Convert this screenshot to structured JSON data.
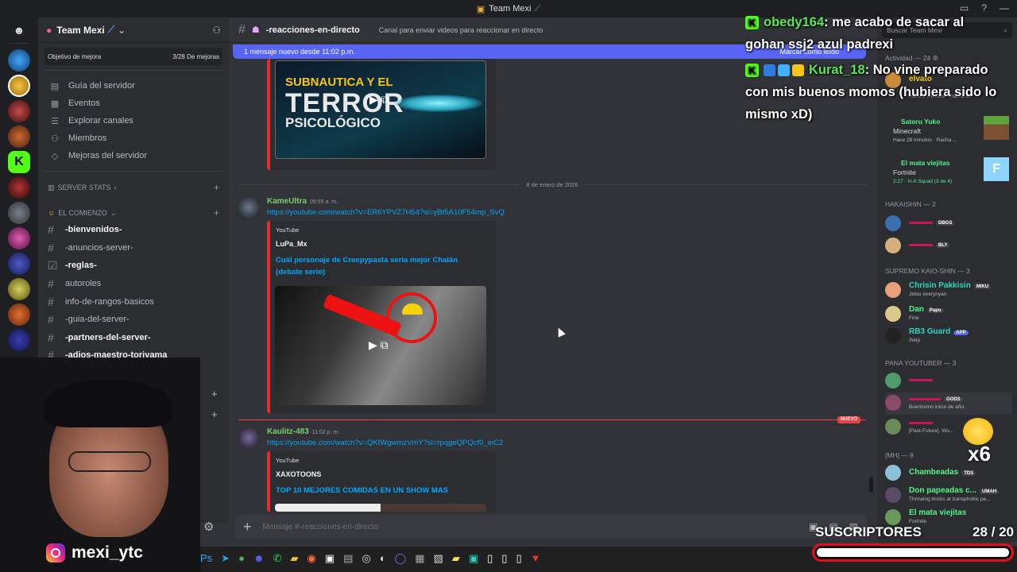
{
  "window": {
    "title": "Team Mexi"
  },
  "server": {
    "name": "Team Mexi",
    "boost_label": "Objetivo de mejora",
    "boost_count": "3/28 De mejoras"
  },
  "nav": [
    "Guía del servidor",
    "Eventos",
    "Explorar canales",
    "Miembros",
    "Mejoras del servidor"
  ],
  "categories": {
    "stats": "SERVER STATS",
    "comienzo": "EL COMIENZO"
  },
  "channels": [
    "-bienvenidos-",
    "-anuncios-server-",
    "-reglas-",
    "autoroles",
    "info-de-rangos-basicos",
    "-guia-del-server-",
    "-partners-del-server-",
    "-adios-maestro-toriyama"
  ],
  "channel": {
    "name": "-reacciones-en-directo",
    "topic": "Canal para enviar videos para reaccionar en directo"
  },
  "newbar": {
    "text": "1 mensaje nuevo desde 11:02 p.m.",
    "action": "Marcar como leído"
  },
  "thumb1": {
    "line1": "SUBNAUTICA Y EL",
    "line2": "TERROR",
    "line3": "PSICOLÓGICO"
  },
  "date_separator": "8 de enero de 2026",
  "messages": [
    {
      "author": "KameUltra",
      "time": "09:55 a. m.",
      "link": "https://youtube.com/watch?v=ER6YPVZ7H54?si=yBt5A10F54mp_SvQ",
      "embed_source": "YouTube",
      "embed_author": "LuPa_Mx",
      "embed_title_1": "Cuál personaje de Creepypasta sería mejor Chalán",
      "embed_title_2": "(debate serio)"
    },
    {
      "author": "Kaulitz-483",
      "time": "11:02 p. m.",
      "link": "https://youtube.com/watch?v=QKtWgwmzVmY?si=rpqgeQPQcf0_eiC2",
      "embed_source": "YouTube",
      "embed_author": "XAXOTOONS",
      "embed_title_1": "TOP 10 MEJORES COMIDAS EN UN SHOW MAS"
    }
  ],
  "new_badge": "NUEVO",
  "composer": {
    "placeholder": "Mensaje #-reacciones-en-directo"
  },
  "members": {
    "search": "Buscar Team Mexi",
    "activity_header": "Actividad — 24",
    "elvato": {
      "name": "elvato",
      "status": "Hace 2 minutos · Racha d..."
    },
    "satoru": {
      "name": "Satoru Yuko",
      "game": "Minecraft",
      "status": "Hace 28 minutos · Racha ..."
    },
    "matav": {
      "name": "El mata viejitas",
      "game": "Fortnite",
      "status": "2:27 · In A Squad (3 de 4)"
    },
    "hakaishin_header": "HAKAISHIN — 2",
    "haka1": {
      "tag": "DBGS"
    },
    "haka2": {
      "tag": "BLY"
    },
    "supremo_header": "SUPREMO KAIO-SHIN — 3",
    "chrisin": {
      "name": "Chrisin Pakkisin",
      "tag": "MIKU",
      "status": "Jelou everynyan"
    },
    "dan": {
      "name": "Dan",
      "tag": "Papu",
      "status": "Fine"
    },
    "rb3": {
      "name": "RB3 Guard",
      "tag": "APP",
      "status": "/help"
    },
    "pana_header": "PANA YOUTUBER — 3",
    "pana2": {
      "tag": "GODS",
      "status": "Buenísimo inicio de año."
    },
    "pana3": {
      "status": "[Past-Future]. Wo..."
    },
    "mh_header": "[MH] — 8",
    "chambeadas": {
      "name": "Chambeadas",
      "tag": "TDS"
    },
    "donpap": {
      "name": "Don papeadas c...",
      "tag": "UMAH",
      "status": "Throwing bricks at transphobic pe..."
    },
    "matav2": {
      "name": "El mata viejitas",
      "status": "Fortnite"
    }
  },
  "overlay": {
    "chat": [
      {
        "user": "obedy164",
        "text": ": me acabo de sacar al",
        "cont": "gohan ssj2 azul padrexi"
      },
      {
        "user": "Kurat_18",
        "text": ": No vine preparado",
        "cont": "con mis buenos momos (hubiera sido lo",
        "cont2": "mismo xD)"
      }
    ],
    "multiplier": "x6",
    "subs_label": "SUSCRIPTORES",
    "subs_current": "28",
    "subs_goal": "/ 20",
    "instagram": "mexi_ytc"
  }
}
